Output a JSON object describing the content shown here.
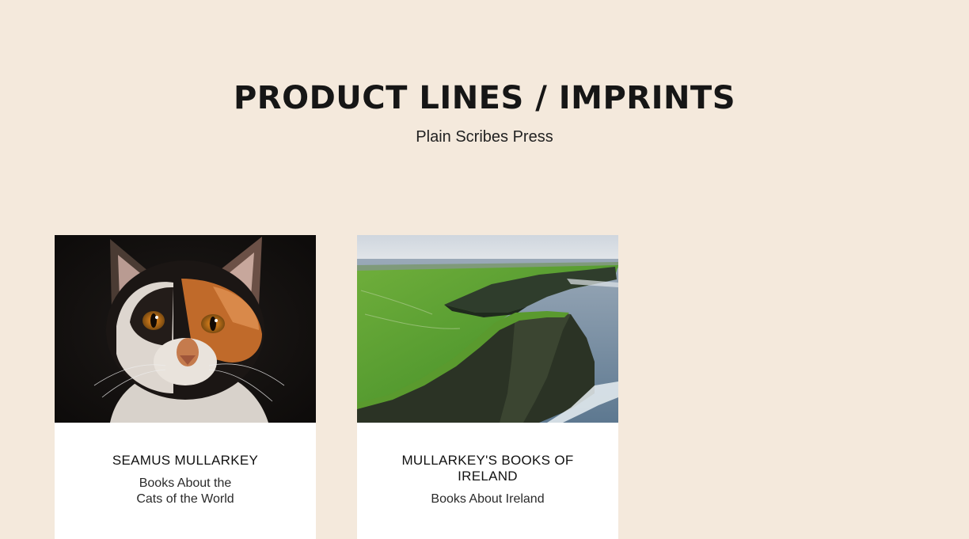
{
  "header": {
    "title": "PRODUCT LINES / IMPRINTS",
    "subtitle": "Plain Scribes Press"
  },
  "cards": [
    {
      "image_icon": "cat-photo",
      "title": "SEAMUS MULLARKEY",
      "description_lines": [
        "Books About the",
        "Cats of the World"
      ]
    },
    {
      "image_icon": "cliffs-photo",
      "title": "MULLARKEY'S BOOKS OF IRELAND",
      "description_lines": [
        "Books About Ireland"
      ]
    }
  ],
  "colors": {
    "background": "#f4e9dc",
    "card": "#ffffff",
    "text": "#161616"
  }
}
